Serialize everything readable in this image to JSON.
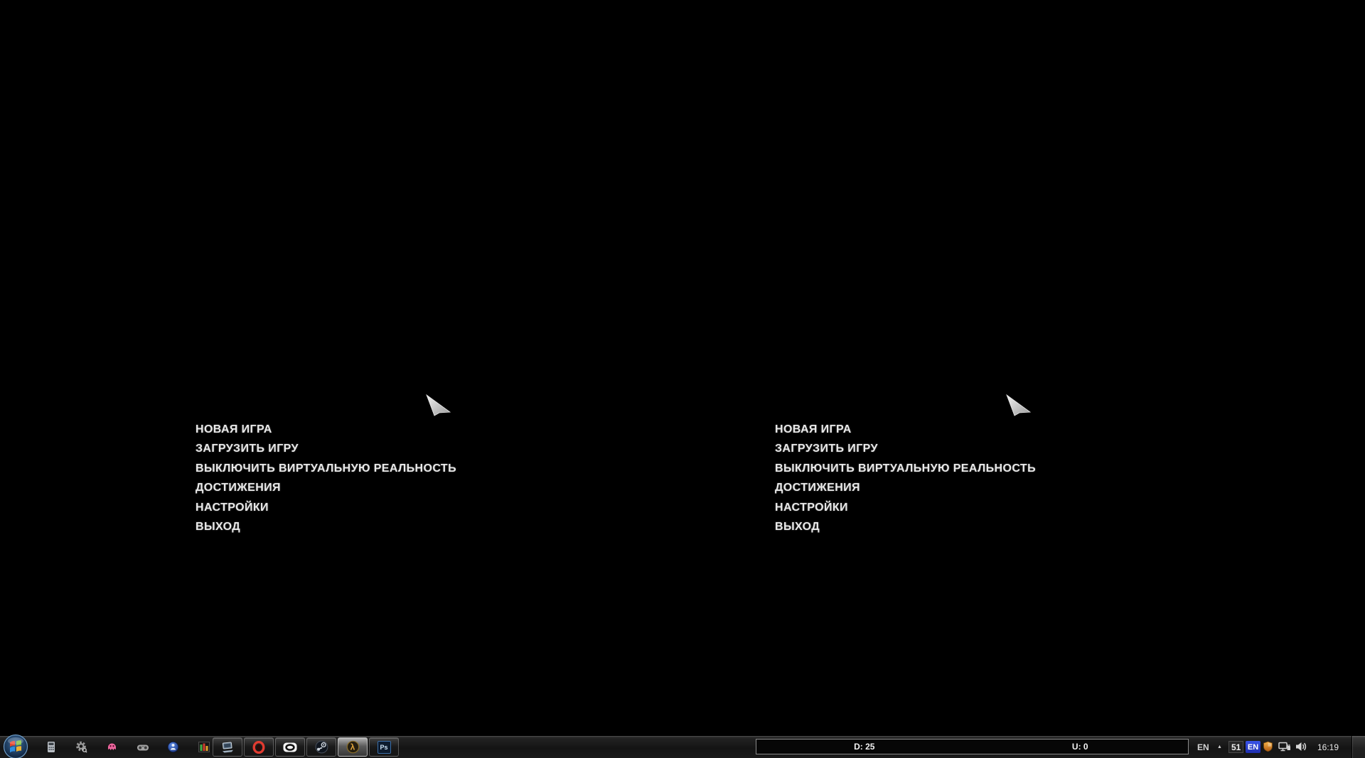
{
  "game": {
    "menu": [
      "НОВАЯ ИГРА",
      "ЗАГРУЗИТЬ ИГРУ",
      "ВЫКЛЮЧИТЬ ВИРТУАЛЬНУЮ РЕАЛЬНОСТЬ",
      "ДОСТИЖЕНИЯ",
      "НАСТРОЙКИ",
      "ВЫХОД"
    ]
  },
  "taskbar": {
    "quick_launch_icons": [
      "calculator-icon",
      "gear-icon",
      "pink-creature-icon",
      "gamepad-icon",
      "blue-globe-icon",
      "chart-icon"
    ],
    "app_buttons": [
      {
        "icon": "laptop-icon",
        "active": false
      },
      {
        "icon": "opera-icon",
        "active": false
      },
      {
        "icon": "oculus-icon",
        "active": false
      },
      {
        "icon": "steam-icon",
        "active": false
      },
      {
        "icon": "half-life-lambda-icon",
        "active": true
      },
      {
        "icon": "photoshop-icon",
        "active": false
      }
    ],
    "glyphs": {
      "lambda": "λ",
      "photoshop": "Ps",
      "hidden_icons_arrow": "▲"
    },
    "net_monitor": {
      "download": "D: 25",
      "upload": "U: 0"
    },
    "tray": {
      "language_bar": "EN",
      "counter": "51",
      "language_badge": "EN",
      "clock": "16:19"
    }
  },
  "colors": {
    "background": "#000000",
    "menu_text": "#e9e9e9",
    "taskbar_bg": "#1a1a1a",
    "language_badge_bg": "#2b3fd0",
    "lambda_orange": "#e0a43a",
    "shield_orange": "#f0a030"
  }
}
